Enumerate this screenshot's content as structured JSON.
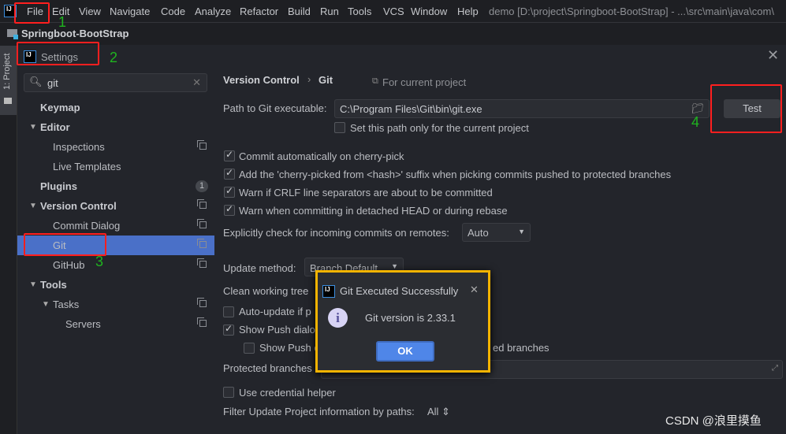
{
  "menubar": {
    "items": [
      "File",
      "Edit",
      "View",
      "Navigate",
      "Code",
      "Analyze",
      "Refactor",
      "Build",
      "Run",
      "Tools",
      "VCS",
      "Window",
      "Help"
    ],
    "title": "demo [D:\\project\\Springboot-BootStrap] - ...\\src\\main\\java\\com\\"
  },
  "project": {
    "name": "Springboot-BootStrap",
    "tool_tab": "1: Project"
  },
  "settings": {
    "title": "Settings",
    "search_value": "git"
  },
  "tree": [
    {
      "label": "Keymap",
      "level": 0,
      "bold": true
    },
    {
      "label": "Editor",
      "level": 0,
      "bold": true,
      "expanded": true
    },
    {
      "label": "Inspections",
      "level": 1,
      "copy": true
    },
    {
      "label": "Live Templates",
      "level": 1
    },
    {
      "label": "Plugins",
      "level": 0,
      "bold": true,
      "badge": "1"
    },
    {
      "label": "Version Control",
      "level": 0,
      "bold": true,
      "expanded": true,
      "copy": true
    },
    {
      "label": "Commit Dialog",
      "level": 1,
      "copy": true
    },
    {
      "label": "Git",
      "level": 1,
      "copy": true,
      "selected": true
    },
    {
      "label": "GitHub",
      "level": 1,
      "copy": true
    },
    {
      "label": "Tools",
      "level": 0,
      "bold": true,
      "expanded": true
    },
    {
      "label": "Tasks",
      "level": 1,
      "expanded": true,
      "copy": true
    },
    {
      "label": "Servers",
      "level": 2,
      "copy": true
    }
  ],
  "content": {
    "breadcrumb": [
      "Version Control",
      "Git"
    ],
    "scope": "For current project",
    "path_label": "Path to Git executable:",
    "path_value": "C:\\Program Files\\Git\\bin\\git.exe",
    "test_button": "Test",
    "path_only_project": "Set this path only for the current project",
    "checks": [
      {
        "label": "Commit automatically on cherry-pick",
        "checked": true
      },
      {
        "label": "Add the 'cherry-picked from <hash>' suffix when picking commits pushed to protected branches",
        "checked": true
      },
      {
        "label": "Warn if CRLF line separators are about to be committed",
        "checked": true
      },
      {
        "label": "Warn when committing in detached HEAD or during rebase",
        "checked": true
      }
    ],
    "incoming_label": "Explicitly check for incoming commits on remotes:",
    "incoming_value": "Auto",
    "update_label": "Update method:",
    "update_value": "Branch Default",
    "clean_label": "Clean working tree",
    "auto_update": {
      "label": "Auto-update if p",
      "checked": false
    },
    "show_push": {
      "label": "Show Push dialo",
      "checked": true
    },
    "show_push_sub": {
      "label": "Show Push c",
      "tail": "ed branches",
      "checked": false
    },
    "protected_label": "Protected branches",
    "protected_value": "master",
    "credential": {
      "label": "Use credential helper",
      "checked": false
    },
    "filter_label": "Filter Update Project information by paths:",
    "filter_value": "All"
  },
  "popup": {
    "title": "Git Executed Successfully",
    "message": "Git version is 2.33.1",
    "ok": "OK"
  },
  "annotations": [
    "1",
    "2",
    "3",
    "4"
  ],
  "watermark": "CSDN @浪里摸鱼",
  "colors": {
    "selection": "#4a70c8",
    "ok_button": "#4f86e8",
    "annotation_box": "#ff1f1f",
    "popup_highlight": "#f5b400",
    "annotation_number": "#1fb41f"
  }
}
